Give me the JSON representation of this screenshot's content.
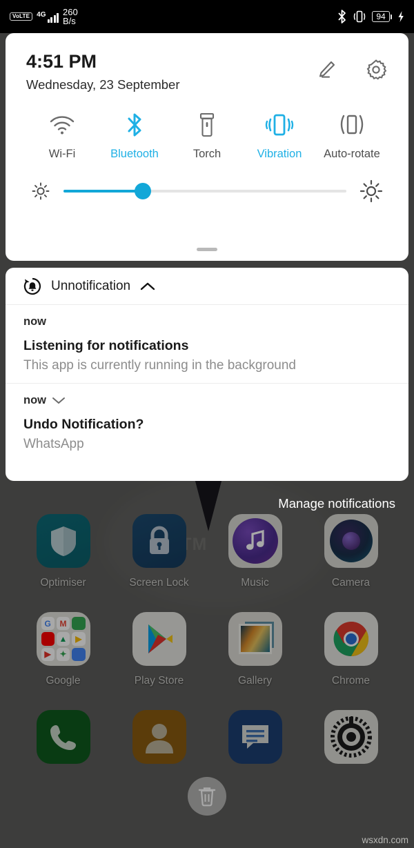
{
  "status_bar": {
    "volte_label": "VoLTE",
    "network_type": "4G",
    "data_speed_value": "260",
    "data_speed_unit": "B/s",
    "bluetooth_icon": "bluetooth-icon",
    "vibrate_icon": "vibrate-icon",
    "battery_level": "94",
    "charging_icon": "charging-bolt-icon"
  },
  "quick_settings": {
    "time": "4:51 PM",
    "date": "Wednesday, 23 September",
    "edit_icon": "pencil-icon",
    "settings_icon": "gear-icon",
    "accent_color": "#1fb0e5",
    "slider_color": "#12a7d8",
    "toggles": [
      {
        "label": "Wi-Fi",
        "icon": "wifi-icon",
        "active": false
      },
      {
        "label": "Bluetooth",
        "icon": "bluetooth-icon",
        "active": true
      },
      {
        "label": "Torch",
        "icon": "torch-icon",
        "active": false
      },
      {
        "label": "Vibration",
        "icon": "vibration-icon",
        "active": true
      },
      {
        "label": "Auto-rotate",
        "icon": "auto-rotate-icon",
        "active": false
      }
    ],
    "brightness": {
      "low_icon": "brightness-low-icon",
      "high_icon": "brightness-high-icon",
      "value_percent": 28
    },
    "drag_handle": "panel-drag-handle"
  },
  "notifications": {
    "app_name": "Unnotification",
    "app_icon": "undo-bell-icon",
    "collapse_icon": "chevron-up-icon",
    "items": [
      {
        "when": "now",
        "title": "Listening for notifications",
        "body": "This app is currently running in the background",
        "expand_icon": ""
      },
      {
        "when": "now",
        "title": "Undo Notification?",
        "body": "WhatsApp",
        "expand_icon": "chevron-down-icon"
      }
    ],
    "manage_label": "Manage notifications"
  },
  "home_screen": {
    "wallpaper_text": "BATM",
    "rows": [
      [
        {
          "label": "Optimiser",
          "icon": "shield-icon"
        },
        {
          "label": "Screen Lock",
          "icon": "lock-icon"
        },
        {
          "label": "Music",
          "icon": "music-note-icon"
        },
        {
          "label": "Camera",
          "icon": "camera-lens-icon"
        }
      ],
      [
        {
          "label": "Google",
          "icon": "google-folder-icon"
        },
        {
          "label": "Play Store",
          "icon": "play-store-icon"
        },
        {
          "label": "Gallery",
          "icon": "gallery-icon"
        },
        {
          "label": "Chrome",
          "icon": "chrome-icon"
        }
      ]
    ],
    "dock": [
      {
        "label": "",
        "icon": "phone-icon"
      },
      {
        "label": "",
        "icon": "contacts-icon"
      },
      {
        "label": "",
        "icon": "messages-icon"
      },
      {
        "label": "",
        "icon": "settings-gear-icon"
      }
    ],
    "trash_bubble_icon": "trash-icon",
    "watermark": "wsxdn.com"
  }
}
